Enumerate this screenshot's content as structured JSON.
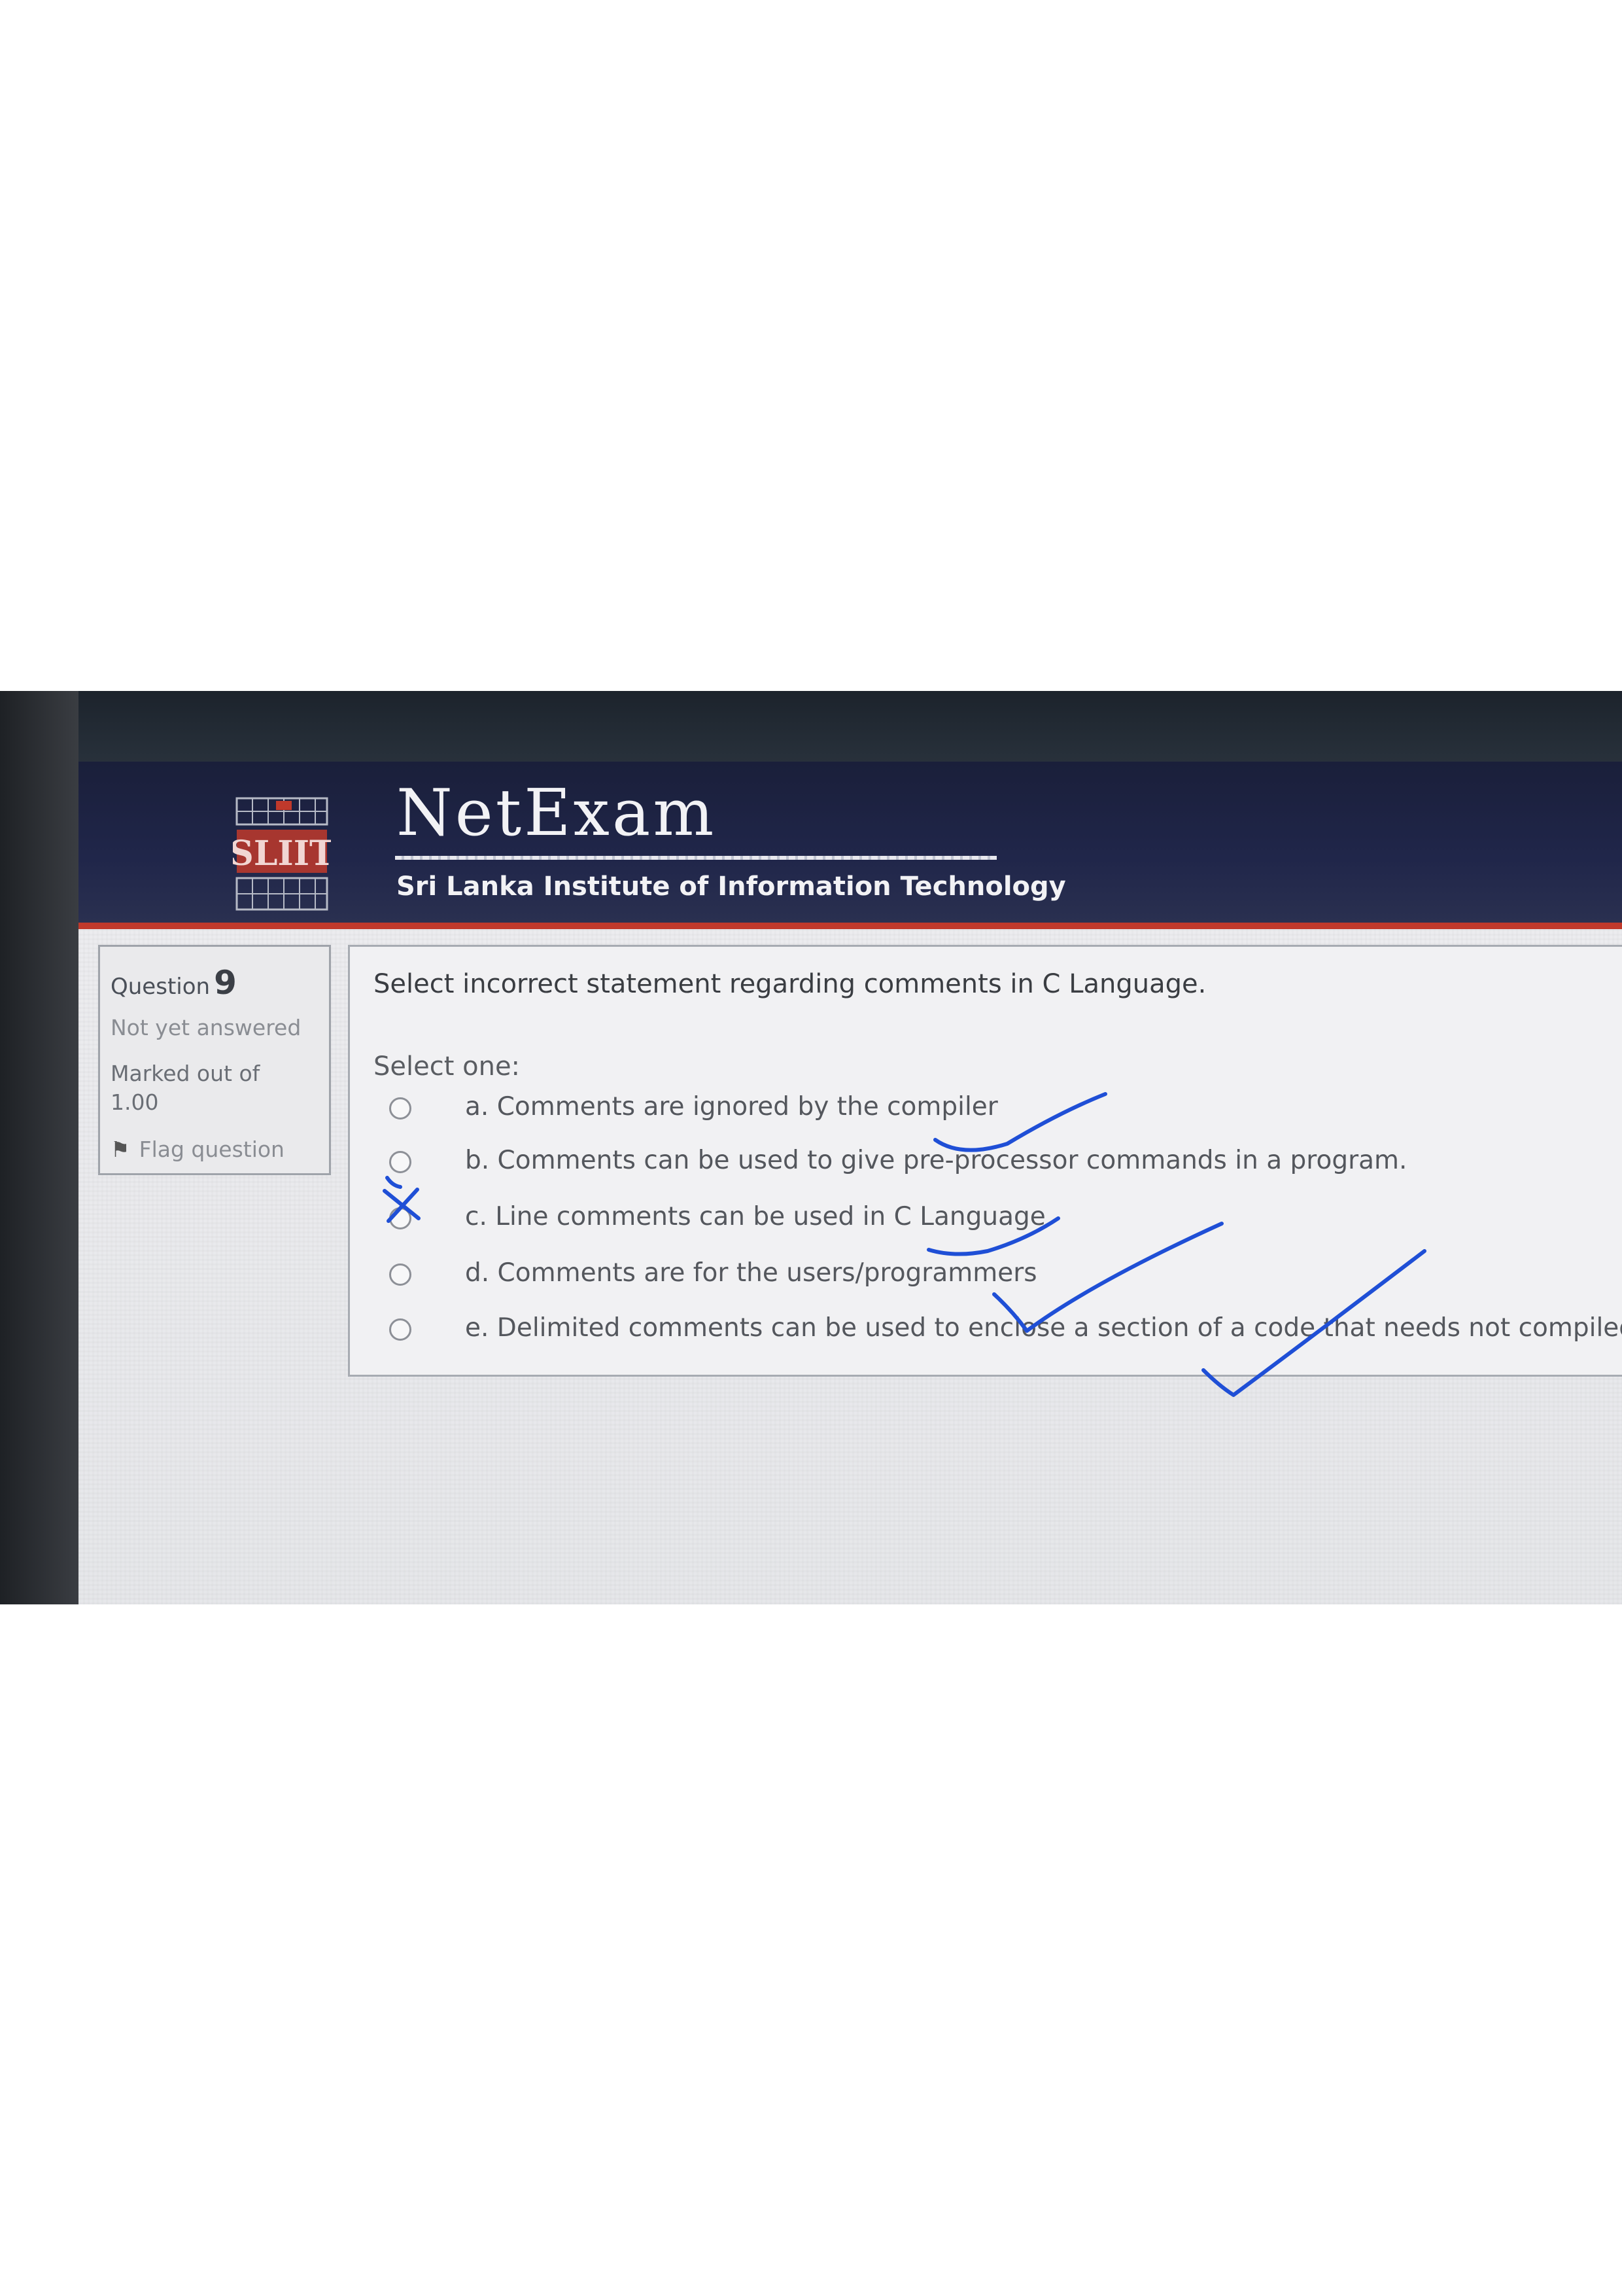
{
  "header": {
    "app_title": "NetExam",
    "institute": "Sri Lanka Institute of Information Technology",
    "logo_text": "SLIIT"
  },
  "question_info": {
    "label": "Question",
    "number": "9",
    "state": "Not yet answered",
    "marked_out_of": "Marked out of 1.00",
    "flag_label": "Flag question"
  },
  "question": {
    "text": "Select incorrect statement regarding comments in C Language.",
    "prompt": "Select one:",
    "options": [
      {
        "label": "a. Comments are ignored by the compiler",
        "selected": false
      },
      {
        "label": "b. Comments can be used to give pre-processor commands in a program.",
        "selected": false
      },
      {
        "label": "c. Line comments can be used in C Language",
        "selected": false
      },
      {
        "label": "d. Comments are for the users/programmers",
        "selected": false
      },
      {
        "label": "e. Delimited comments can be used to enclose a section of a code that needs not compiled",
        "selected": false
      }
    ]
  },
  "annotations": {
    "ink_color": "#1f4fd6",
    "marks": [
      "check-a",
      "cross-b",
      "check-c",
      "check-d",
      "check-e"
    ]
  },
  "colors": {
    "header_bg": "#1a1f3a",
    "header_accent": "#c0392b",
    "logo_red": "#c0392b"
  }
}
